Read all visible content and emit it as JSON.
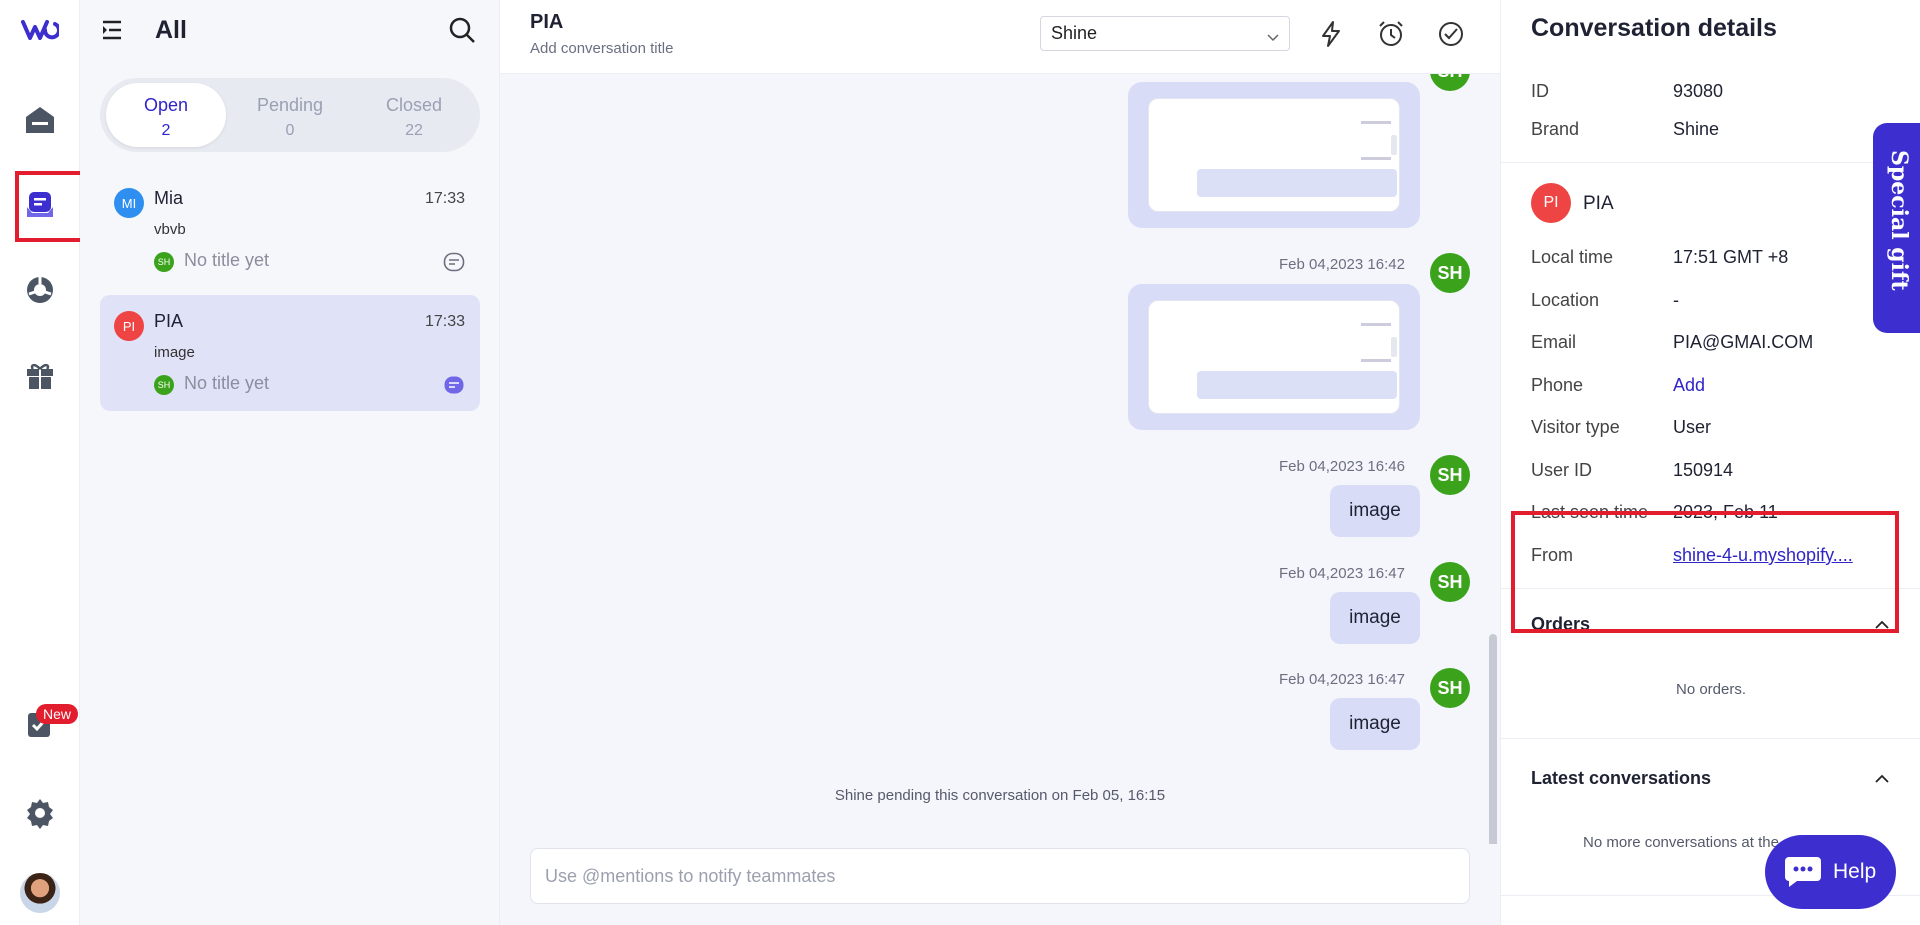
{
  "rail": {
    "new_badge": "New",
    "items": [
      "logo-icon",
      "home-icon",
      "conversations-icon",
      "reports-icon",
      "gift-icon",
      "tasks-icon",
      "settings-icon",
      "avatar"
    ]
  },
  "list": {
    "title": "All",
    "tabs": [
      {
        "label": "Open",
        "count": "2"
      },
      {
        "label": "Pending",
        "count": "0"
      },
      {
        "label": "Closed",
        "count": "22"
      }
    ],
    "conversations": [
      {
        "initials": "MI",
        "name": "Mia",
        "time": "17:33",
        "message": "vbvb",
        "agent": "SH",
        "title": "No title yet",
        "color": "#2f8ff0"
      },
      {
        "initials": "PI",
        "name": "PIA",
        "time": "17:33",
        "message": "image",
        "agent": "SH",
        "title": "No title yet",
        "color": "#ef4444"
      }
    ]
  },
  "chat": {
    "name": "PIA",
    "subtitle": "Add conversation title",
    "brand_select": "Shine",
    "messages": [
      {
        "timestamp": "",
        "type": "image",
        "agent": "SH"
      },
      {
        "timestamp": "Feb 04,2023 16:42",
        "type": "image",
        "agent": "SH"
      },
      {
        "timestamp": "Feb 04,2023 16:46",
        "type": "text",
        "text": "image",
        "agent": "SH"
      },
      {
        "timestamp": "Feb 04,2023 16:47",
        "type": "text",
        "text": "image",
        "agent": "SH"
      },
      {
        "timestamp": "Feb 04,2023 16:47",
        "type": "text",
        "text": "image",
        "agent": "SH"
      }
    ],
    "system_message": "Shine pending this conversation on Feb 05, 16:15",
    "composer_placeholder": "Use @mentions to notify teammates"
  },
  "details": {
    "title": "Conversation details",
    "id_label": "ID",
    "id_value": "93080",
    "brand_label": "Brand",
    "brand_value": "Shine",
    "customer_initials": "PI",
    "customer_name": "PIA",
    "rows": [
      {
        "label": "Local time",
        "value": "17:51 GMT +8"
      },
      {
        "label": "Location",
        "value": "-"
      },
      {
        "label": "Email",
        "value": "PIA@GMAI.COM"
      },
      {
        "label": "Phone",
        "value": "Add"
      },
      {
        "label": "Visitor type",
        "value": "User"
      },
      {
        "label": "User ID",
        "value": "150914"
      },
      {
        "label": "Last seen time",
        "value": "2023, Feb 11"
      },
      {
        "label": "From",
        "value": "shine-4-u.myshopify...."
      }
    ],
    "orders_title": "Orders",
    "orders_empty": "No orders.",
    "latest_title": "Latest conversations",
    "latest_empty": "No more conversations at the"
  },
  "widgets": {
    "special_gift": "Special gift",
    "help": "Help"
  },
  "colors": {
    "accent": "#3d2fcf",
    "agent": "#3aa31b",
    "highlight": "#e11d2e"
  }
}
